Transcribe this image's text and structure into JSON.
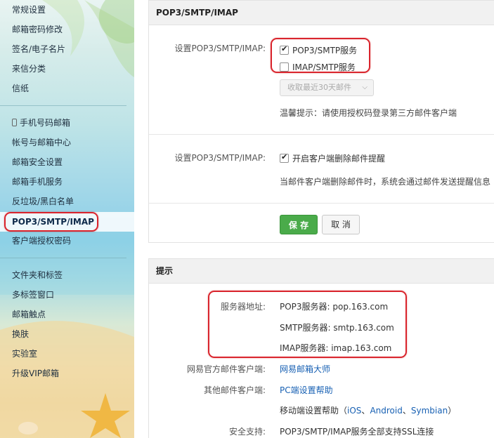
{
  "sidebar": {
    "group1": [
      "常规设置",
      "邮箱密码修改",
      "签名/电子名片",
      "来信分类",
      "信纸"
    ],
    "group2": [
      "手机号码邮箱",
      "帐号与邮箱中心",
      "邮箱安全设置",
      "邮箱手机服务",
      "反垃圾/黑白名单",
      "POP3/SMTP/IMAP",
      "客户端授权密码"
    ],
    "group3": [
      "文件夹和标签",
      "多标签窗口",
      "邮箱触点",
      "换肤",
      "实验室",
      "升级VIP邮箱"
    ],
    "active": "POP3/SMTP/IMAP"
  },
  "panel1": {
    "title": "POP3/SMTP/IMAP",
    "row1_label": "设置POP3/SMTP/IMAP:",
    "pop3_smtp_label": "POP3/SMTP服务",
    "pop3_smtp_checked": true,
    "imap_smtp_label": "IMAP/SMTP服务",
    "imap_smtp_checked": false,
    "select_label": "收取最近30天邮件",
    "tip": "温馨提示：请使用授权码登录第三方邮件客户端",
    "row2_label": "设置POP3/SMTP/IMAP:",
    "delete_alert_label": "开启客户端删除邮件提醒",
    "delete_alert_checked": true,
    "delete_alert_desc": "当邮件客户端删除邮件时，系统会通过邮件发送提醒信息",
    "save_label": "保 存",
    "cancel_label": "取 消"
  },
  "panel2": {
    "title": "提示",
    "server_label": "服务器地址:",
    "pop3_server": "POP3服务器: pop.163.com",
    "smtp_server": "SMTP服务器: smtp.163.com",
    "imap_server": "IMAP服务器: imap.163.com",
    "official_client_label": "网易官方邮件客户端:",
    "official_client_link": "网易邮箱大师",
    "other_client_label": "其他邮件客户端:",
    "other_client_link": "PC端设置帮助",
    "mobile_prefix": "移动端设置帮助（",
    "mobile_ios": "iOS",
    "mobile_sep1": "、",
    "mobile_android": "Android",
    "mobile_sep2": "、",
    "mobile_symbian": "Symbian",
    "mobile_suffix": "）",
    "security_label": "安全支持:",
    "security_text": "POP3/SMTP/IMAP服务全部支持SSL连接"
  },
  "colors": {
    "highlight_ring": "#d9242c",
    "save_green": "#4aab4a",
    "link_blue": "#1760b3"
  }
}
